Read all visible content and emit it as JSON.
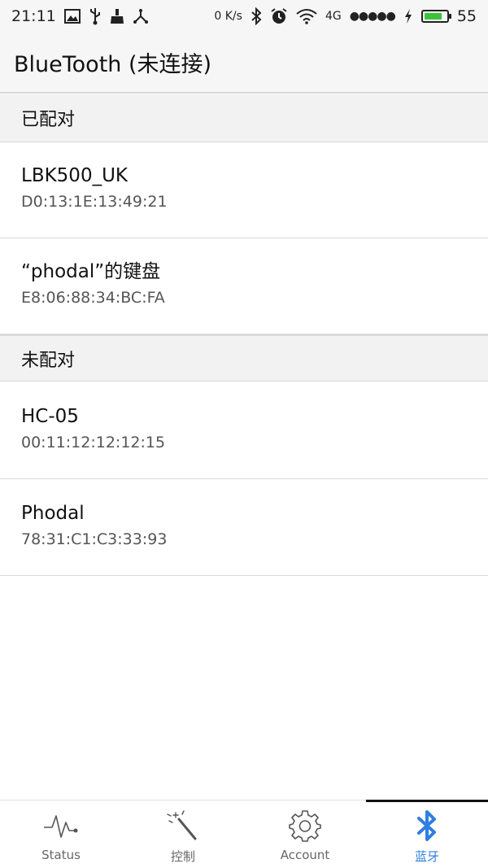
{
  "status_bar": {
    "time": "21:11",
    "net_speed": "0 K/s",
    "network": "4G",
    "signal_dots": "●●●●●",
    "battery_level": "55",
    "battery_fraction": 0.8,
    "battery_color": "#3cc23c"
  },
  "app_bar": {
    "title": "BlueTooth (未连接)"
  },
  "paired_section": {
    "header": "已配对",
    "devices": [
      {
        "name": "LBK500_UK",
        "address": "D0:13:1E:13:49:21"
      },
      {
        "name": "“phodal”的键盘",
        "address": "E8:06:88:34:BC:FA"
      }
    ]
  },
  "unpaired_section": {
    "header": "未配对",
    "devices": [
      {
        "name": "HC-05",
        "address": "00:11:12:12:12:15"
      },
      {
        "name": "Phodal",
        "address": "78:31:C1:C3:33:93"
      }
    ]
  },
  "bottom_nav": {
    "active_color": "#2f7fe0",
    "tabs": [
      {
        "label": "Status",
        "icon": "pulse-icon"
      },
      {
        "label": "控制",
        "icon": "magic-wand-icon"
      },
      {
        "label": "Account",
        "icon": "gear-icon"
      },
      {
        "label": "蓝牙",
        "icon": "bluetooth-icon"
      }
    ]
  }
}
